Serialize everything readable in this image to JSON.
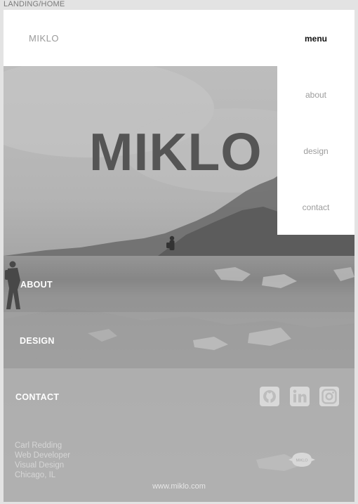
{
  "frame": {
    "label": "LANDING/HOME"
  },
  "header": {
    "brand": "MIKLO"
  },
  "menu": {
    "title": "menu",
    "items": [
      {
        "label": "about"
      },
      {
        "label": "design"
      },
      {
        "label": "contact"
      }
    ]
  },
  "hero": {
    "title": "MIKLO"
  },
  "sections": [
    {
      "label": "ABOUT"
    },
    {
      "label": "DESIGN"
    },
    {
      "label": "CONTACT"
    }
  ],
  "social": [
    {
      "icon": "github-icon"
    },
    {
      "icon": "linkedin-icon"
    },
    {
      "icon": "instagram-icon"
    }
  ],
  "info": {
    "name": "Carl Redding",
    "role": "Web Developer",
    "discipline": "Visual Design",
    "location": "Chicago, IL"
  },
  "badge": {
    "text": "MIKLO"
  },
  "footer": {
    "url": "www.miklo.com"
  }
}
